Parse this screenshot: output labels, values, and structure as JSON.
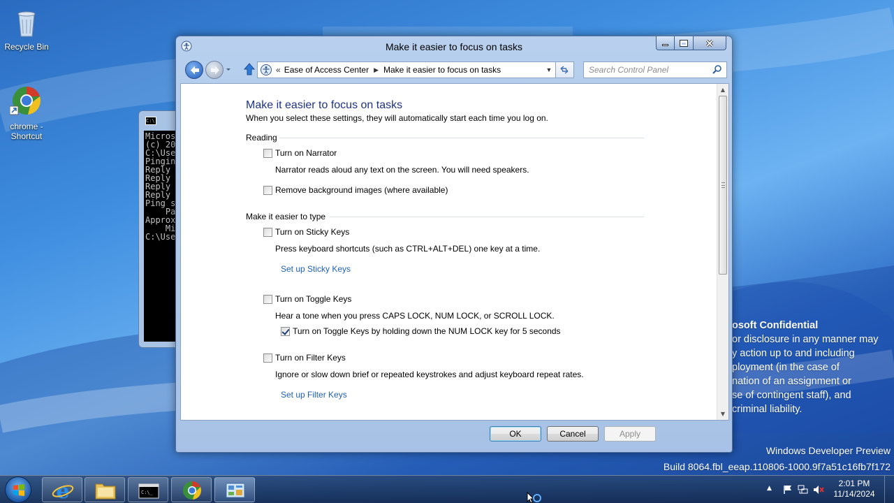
{
  "desktop": {
    "icons": [
      {
        "label": "Recycle Bin"
      },
      {
        "label_line1": "chrome -",
        "label_line2": "Shortcut"
      }
    ],
    "watermark": {
      "confidential_lines": [
        "osoft Confidential",
        "or disclosure in any manner may",
        "y action up to and including",
        "ployment (in the case of",
        "nation of an assignment or",
        "se of contingent staff), and",
        "criminal liability."
      ],
      "edition": "Windows Developer Preview",
      "build": "Build 8064.fbl_eeap.110806-1000.9f7a51c16fb7f172"
    }
  },
  "console": {
    "lines": [
      "Micros",
      "(c) 20",
      "",
      "C:\\Use",
      "",
      "Pingin",
      "Reply ",
      "Reply ",
      "Reply ",
      "Reply ",
      "",
      "Ping s",
      "    Pa",
      "Approx",
      "    Mi",
      "",
      "C:\\Use"
    ]
  },
  "window": {
    "title": "Make it easier to focus on tasks",
    "address": {
      "crumbs": [
        "Ease of Access Center",
        "Make it easier to focus on tasks"
      ]
    },
    "search": {
      "placeholder": "Search Control Panel"
    },
    "content": {
      "title": "Make it easier to focus on tasks",
      "subtitle": "When you select these settings, they will automatically start each time you log on.",
      "reading": {
        "label": "Reading",
        "narrator": {
          "label": "Turn on Narrator",
          "checked": false,
          "desc": "Narrator reads aloud any text on the screen. You will need speakers."
        },
        "bg_images": {
          "label": "Remove background images (where available)",
          "checked": false
        }
      },
      "typing": {
        "label": "Make it easier to type",
        "sticky": {
          "label": "Turn on Sticky Keys",
          "checked": false,
          "desc": "Press keyboard shortcuts (such as CTRL+ALT+DEL) one key at a time.",
          "link": "Set up Sticky Keys"
        },
        "toggle": {
          "label": "Turn on Toggle Keys",
          "checked": false,
          "desc": "Hear a tone when you press CAPS LOCK, NUM LOCK, or SCROLL LOCK.",
          "sub": {
            "label": "Turn on Toggle Keys by holding down the NUM LOCK key for 5 seconds",
            "checked": true
          }
        },
        "filter": {
          "label": "Turn on Filter Keys",
          "checked": false,
          "desc": "Ignore or slow down brief or repeated keystrokes and adjust keyboard repeat rates.",
          "link": "Set up Filter Keys"
        }
      }
    },
    "buttons": {
      "ok": "OK",
      "cancel": "Cancel",
      "apply": "Apply"
    }
  },
  "taskbar": {
    "clock_time": "2:01 PM",
    "clock_date": "11/14/2024"
  },
  "colors": {
    "title_blue": "#1e3287",
    "link_blue": "#1e5fb4"
  }
}
